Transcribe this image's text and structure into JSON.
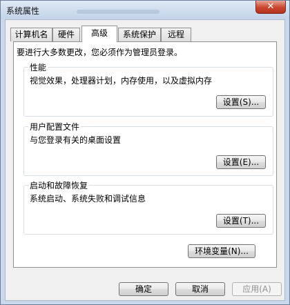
{
  "window": {
    "title": "系统属性",
    "close_symbol": "✕"
  },
  "tabs": [
    {
      "label": "计算机名"
    },
    {
      "label": "硬件"
    },
    {
      "label": "高级"
    },
    {
      "label": "系统保护"
    },
    {
      "label": "远程"
    }
  ],
  "active_tab": "高级",
  "main": {
    "intro": "要进行大多数更改，您必须作为管理员登录。",
    "groups": [
      {
        "title": "性能",
        "description": "视觉效果，处理器计划，内存使用，以及虚拟内存",
        "button": "设置(S)..."
      },
      {
        "title": "用户配置文件",
        "description": "与您登录有关的桌面设置",
        "button": "设置(E)..."
      },
      {
        "title": "启动和故障恢复",
        "description": "系统启动、系统失败和调试信息",
        "button": "设置(T)..."
      }
    ],
    "env_button": "环境变量(N)..."
  },
  "footer": {
    "ok": "确定",
    "cancel": "取消",
    "apply": "应用(A)"
  }
}
